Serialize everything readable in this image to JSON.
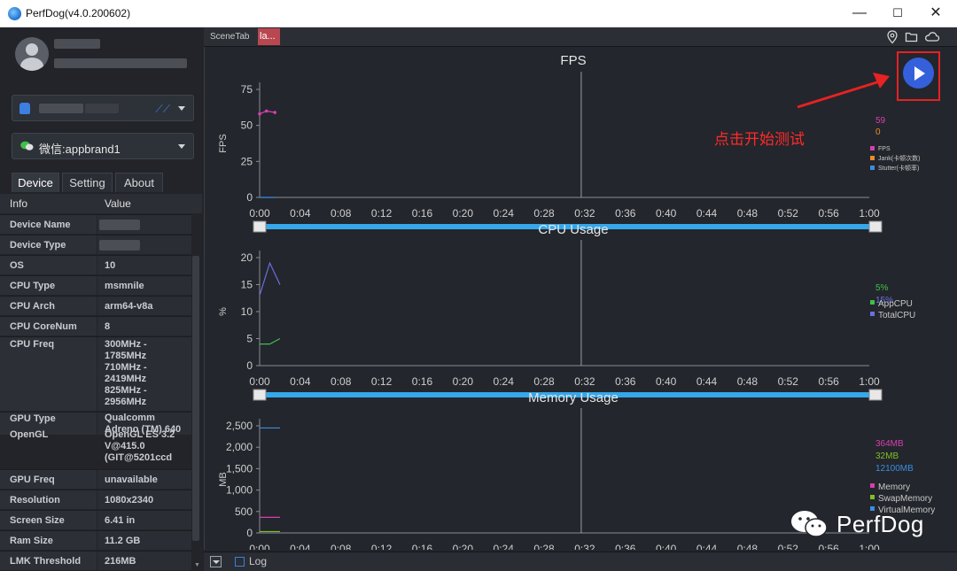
{
  "window": {
    "title": "PerfDog(v4.0.200602)",
    "minimize": "—",
    "maximize": "☐",
    "close": "✕"
  },
  "device_selector": {
    "value": ""
  },
  "app_selector": {
    "value": "微信:appbrand1"
  },
  "tabs": [
    "Device",
    "Setting",
    "About"
  ],
  "info_header": {
    "key": "Info",
    "value": "Value"
  },
  "info_rows": [
    {
      "key": "Device Name",
      "value": ""
    },
    {
      "key": "Device Type",
      "value": ""
    },
    {
      "key": "OS",
      "value": "10"
    },
    {
      "key": "CPU Type",
      "value": "msmnile"
    },
    {
      "key": "CPU Arch",
      "value": "arm64-v8a"
    },
    {
      "key": "CPU CoreNum",
      "value": "8"
    },
    {
      "key": "CPU Freq",
      "value": "300MHz - 1785MHz 710MHz - 2419MHz 825MHz - 2956MHz"
    },
    {
      "key": "GPU Type",
      "value": "Qualcomm Adreno (TM) 640"
    },
    {
      "key": "OpenGL",
      "value": "OpenGL ES 3.2 V@415.0 (GIT@5201ccd"
    },
    {
      "key": "GPU Freq",
      "value": "unavailable"
    },
    {
      "key": "Resolution",
      "value": "1080x2340"
    },
    {
      "key": "Screen Size",
      "value": "6.41 in"
    },
    {
      "key": "Ram Size",
      "value": "11.2 GB"
    },
    {
      "key": "LMK Threshold",
      "value": "216MB"
    }
  ],
  "scene_tab": {
    "label": "SceneTab",
    "active_tab": "la..."
  },
  "top_icons": [
    "location-icon",
    "folder-icon",
    "cloud-icon"
  ],
  "start_button_hint": "点击开始测试",
  "bottom_bar": {
    "log_label": "Log"
  },
  "watermark": "PerfDog",
  "colors": {
    "fps": "#d63fb0",
    "jank": "#f08a2a",
    "stutter": "#3a8ee0",
    "appcpu": "#3fbf4a",
    "totalcpu": "#6a6fe0",
    "memory": "#d63fb0",
    "swap": "#7fbf25",
    "virtual": "#3a8ee0",
    "timeline": "#35a7ea",
    "annotation": "#e62222"
  },
  "chart_data": [
    {
      "type": "line",
      "title": "FPS",
      "ylabel": "FPS",
      "ylim": [
        0,
        75
      ],
      "yticks": [
        "75",
        "50",
        "25",
        "0"
      ],
      "xticks": [
        "0:00",
        "0:04",
        "0:08",
        "0:12",
        "0:16",
        "0:20",
        "0:24",
        "0:28",
        "0:32",
        "0:36",
        "0:40",
        "0:44",
        "0:48",
        "0:52",
        "0:56",
        "1:00"
      ],
      "series": [
        {
          "name": "FPS",
          "current": "59",
          "x": [
            0,
            0.67,
            1.5
          ],
          "values": [
            58,
            60,
            59
          ]
        },
        {
          "name": "Jank(卡顿次数)",
          "current": "0",
          "x": [],
          "values": []
        },
        {
          "name": "Stutter(卡顿率)",
          "current": "",
          "x": [
            0,
            1.5
          ],
          "values": [
            0,
            0
          ]
        }
      ]
    },
    {
      "type": "line",
      "title": "CPU Usage",
      "ylabel": "%",
      "ylim": [
        0,
        20
      ],
      "yticks": [
        "20",
        "15",
        "10",
        "5",
        "0"
      ],
      "xticks": [
        "0:00",
        "0:04",
        "0:08",
        "0:12",
        "0:16",
        "0:20",
        "0:24",
        "0:28",
        "0:32",
        "0:36",
        "0:40",
        "0:44",
        "0:48",
        "0:52",
        "0:56",
        "1:00"
      ],
      "series": [
        {
          "name": "AppCPU",
          "current": "5%",
          "x": [
            0,
            1,
            2
          ],
          "values": [
            4,
            4,
            5
          ]
        },
        {
          "name": "TotalCPU",
          "current": "15%",
          "x": [
            0,
            1,
            2
          ],
          "values": [
            13,
            19,
            15
          ]
        }
      ]
    },
    {
      "type": "line",
      "title": "Memory Usage",
      "ylabel": "MB",
      "ylim": [
        0,
        2500
      ],
      "yticks": [
        "2,500",
        "2,000",
        "1,500",
        "1,000",
        "500",
        "0"
      ],
      "xticks": [
        "0:00",
        "0:04",
        "0:08",
        "0:12",
        "0:16",
        "0:20",
        "0:24",
        "0:28",
        "0:32",
        "0:36",
        "0:40",
        "0:44",
        "0:48",
        "0:52",
        "0:56",
        "1:00"
      ],
      "series": [
        {
          "name": "Memory",
          "current": "364MB",
          "x": [
            0,
            2
          ],
          "values": [
            364,
            364
          ]
        },
        {
          "name": "SwapMemory",
          "current": "32MB",
          "x": [
            0,
            2
          ],
          "values": [
            32,
            32
          ]
        },
        {
          "name": "VirtualMemory",
          "current": "12100MB",
          "x": [
            0,
            2
          ],
          "values": [
            2450,
            2450
          ]
        }
      ]
    }
  ]
}
